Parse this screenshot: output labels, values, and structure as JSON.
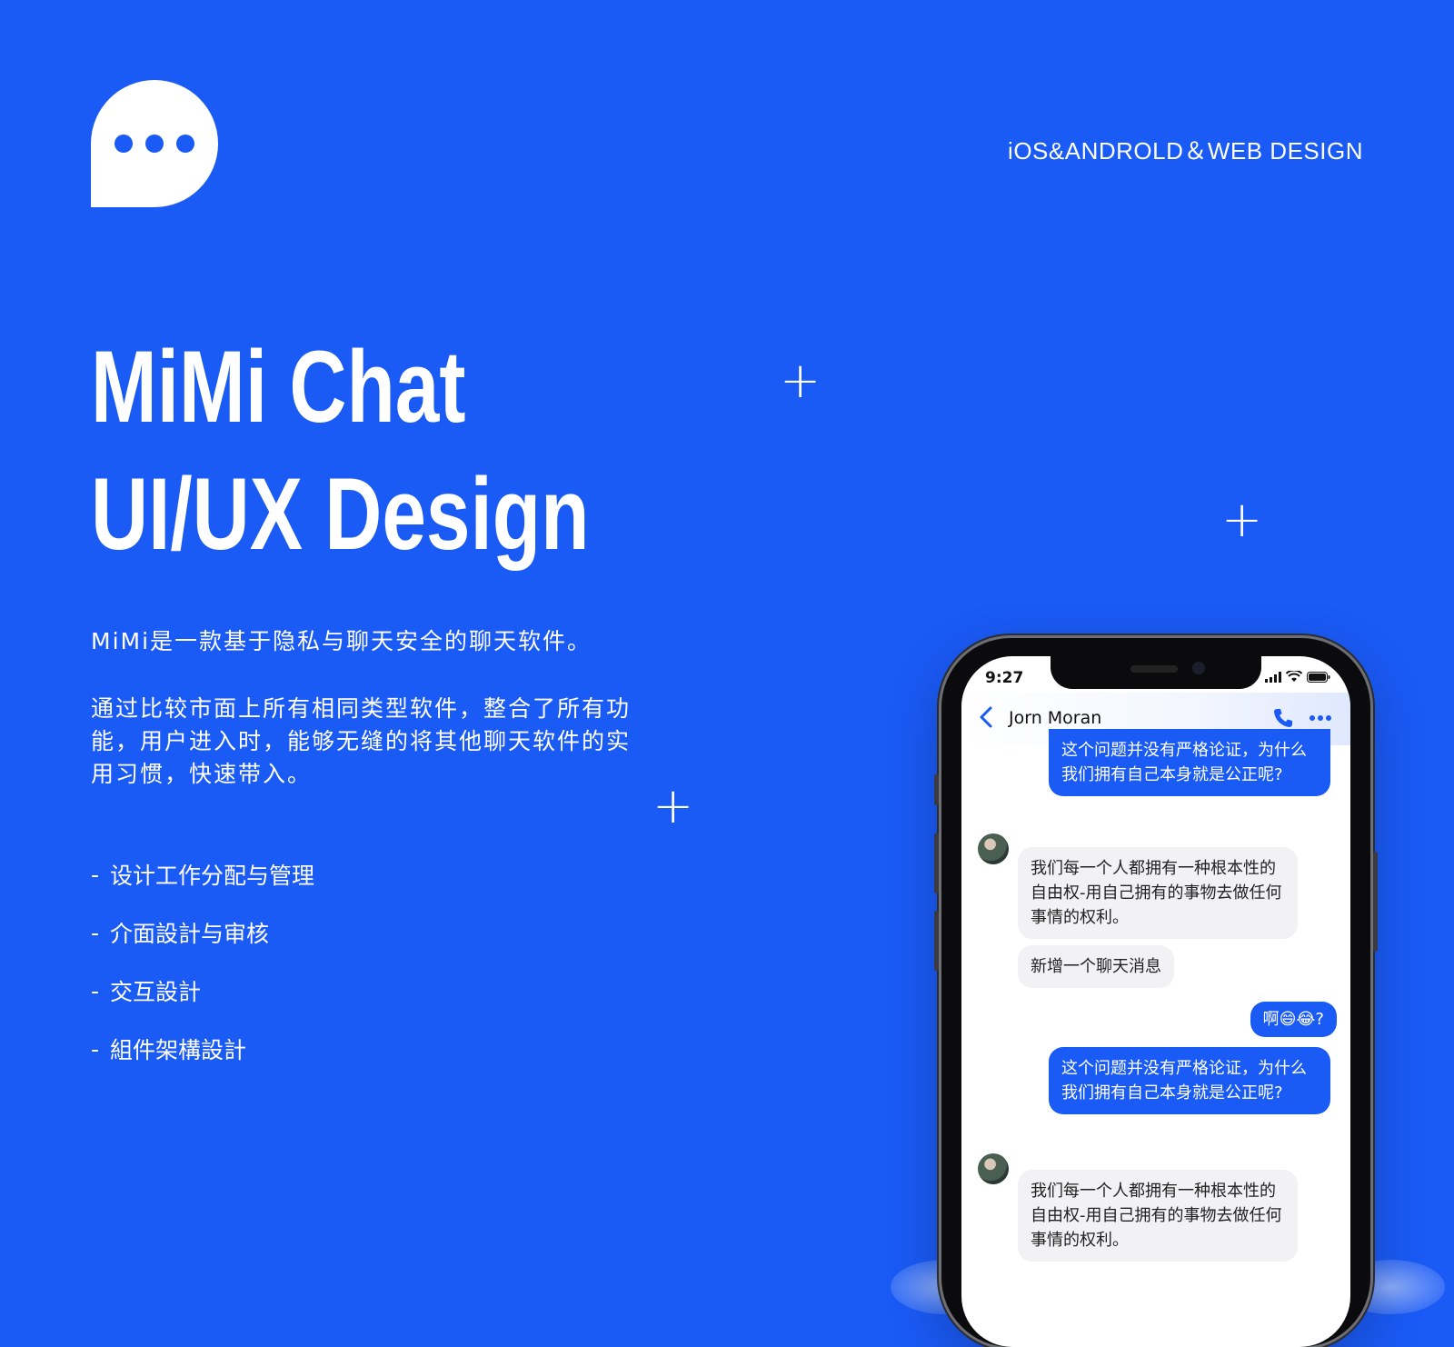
{
  "colors": {
    "background": "#1a5af5",
    "bubble_out": "#1a5af5",
    "bubble_in": "#f2f2f4"
  },
  "header": {
    "logo_icon": "chat-bubble-icon",
    "tagline": "iOS&ANDROLD＆WEB DESIGN"
  },
  "hero": {
    "title_line1": "MiMi Chat",
    "title_line2": "UI/UX Design",
    "intro": "MiMi是一款基于隐私与聊天安全的聊天软件。",
    "description": "通过比较市面上所有相同类型软件，整合了所有功能，用户进入时，能够无缝的将其他聊天软件的实用习惯，快速带入。",
    "features": [
      {
        "dash": "-",
        "label": "设计工作分配与管理"
      },
      {
        "dash": "-",
        "label": "介面設計与审核"
      },
      {
        "dash": "-",
        "label": "交互設計"
      },
      {
        "dash": "-",
        "label": "組件架構設計"
      }
    ]
  },
  "decor": {
    "plus": "+"
  },
  "phone": {
    "time": "9:27",
    "contact_name": "Jorn Moran",
    "messages": [
      {
        "dir": "out",
        "text": "这个问题并没有严格论证，为什么我们拥有自己本身就是公正呢?"
      },
      {
        "dir": "in",
        "text": "我们每一个人都拥有一种根本性的自由权-用自己拥有的事物去做任何事情的权利。"
      },
      {
        "dir": "in",
        "text": "新增一个聊天消息"
      },
      {
        "dir": "out",
        "text": "啊😄😂?"
      },
      {
        "dir": "out",
        "text": "这个问题并没有严格论证，为什么我们拥有自己本身就是公正呢?"
      },
      {
        "dir": "in",
        "text": "我们每一个人都拥有一种根本性的自由权-用自己拥有的事物去做任何事情的权利。"
      }
    ]
  }
}
